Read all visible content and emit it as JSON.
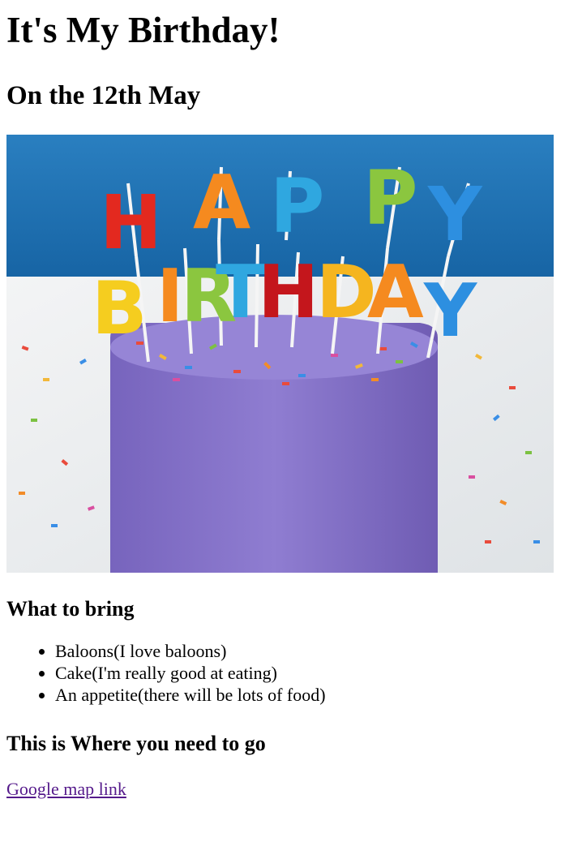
{
  "page": {
    "title": "It's My Birthday!",
    "subtitle": "On the 12th May"
  },
  "hero_image": {
    "description_icon": "birthday-cake-image",
    "candle_letters_top": [
      "H",
      "A",
      "P",
      "P",
      "Y"
    ],
    "candle_letters_bottom": [
      "B",
      "I",
      "R",
      "T",
      "H",
      "D",
      "A",
      "Y"
    ],
    "colors": {
      "background_blue": "#1f73b3",
      "frosting_purple": "#8a77cc",
      "table_white": "#e9ecee"
    }
  },
  "bring": {
    "heading": "What to bring",
    "items": [
      "Baloons(I love baloons)",
      "Cake(I'm really good at eating)",
      "An appetite(there will be lots of food)"
    ]
  },
  "where": {
    "heading": "This is Where you need to go",
    "link_text": "Google map link"
  },
  "colors": {
    "visited_link": "#551a8b"
  }
}
